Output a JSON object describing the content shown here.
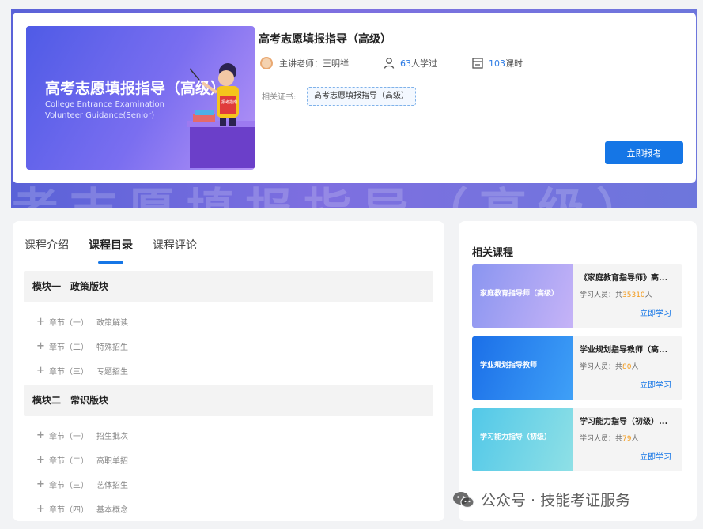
{
  "hero": {
    "ghost_text": "考志愿填报指导（高级）",
    "cover": {
      "title": "高考志愿填报指导（高级）",
      "subtitle_en_1": "College Entrance Examination",
      "subtitle_en_2": "Volunteer Guidance(Senior)",
      "book_label": "报考指南"
    },
    "course_title": "高考志愿填报指导（高级）",
    "teacher_label": "主讲老师：王明祥",
    "learners_count": "63",
    "learners_suffix": "人学过",
    "lessons_count": "103",
    "lessons_suffix": "课时",
    "cert_label": "相关证书:",
    "cert_value": "高考志愿填报指导（高级）",
    "enroll_label": "立即报考",
    "icons": {
      "teacher": "avatar-icon",
      "learners": "user-icon",
      "lessons": "lessons-icon"
    }
  },
  "tabs": [
    {
      "label": "课程介绍",
      "active": false
    },
    {
      "label": "课程目录",
      "active": true
    },
    {
      "label": "课程评论",
      "active": false
    }
  ],
  "modules": [
    {
      "title": "模块一　政策版块",
      "chapters": [
        {
          "num": "章节（一）",
          "name": "政策解读"
        },
        {
          "num": "章节（二）",
          "name": "特殊招生"
        },
        {
          "num": "章节（三）",
          "name": "专题招生"
        }
      ]
    },
    {
      "title": "模块二　常识版块",
      "chapters": [
        {
          "num": "章节（一）",
          "name": "招生批次"
        },
        {
          "num": "章节（二）",
          "name": "高职单招"
        },
        {
          "num": "章节（三）",
          "name": "艺体招生"
        },
        {
          "num": "章节（四）",
          "name": "基本概念"
        }
      ]
    }
  ],
  "related": {
    "title": "相关课程",
    "items": [
      {
        "name": "《家庭教育指导师》高...",
        "count_prefix": "学习人员：共",
        "count": "35310",
        "count_suffix": "人",
        "link": "立即学习",
        "thumb_text": "家庭教育指导师（高级）",
        "thumb_color_a": "#8a95f0",
        "thumb_color_b": "#c6b3f7"
      },
      {
        "name": "学业规划指导教师（高...",
        "count_prefix": "学习人员：共",
        "count": "80",
        "count_suffix": "人",
        "link": "立即学习",
        "thumb_text": "学业规划指导教师",
        "thumb_color_a": "#1b6fe8",
        "thumb_color_b": "#3fa0f7"
      },
      {
        "name": "学习能力指导（初级）...",
        "count_prefix": "学习人员：共",
        "count": "79",
        "count_suffix": "人",
        "link": "立即学习",
        "thumb_text": "学习能力指导（初级）",
        "thumb_color_a": "#52c8e8",
        "thumb_color_b": "#8fe0e6"
      }
    ]
  },
  "watermark": {
    "text": "公众号 · 技能考证服务",
    "icon": "wechat-icon"
  },
  "colors": {
    "accent": "#1576e6",
    "count_highlight": "#f39b1c",
    "hero_bg": "#6a6edc"
  }
}
